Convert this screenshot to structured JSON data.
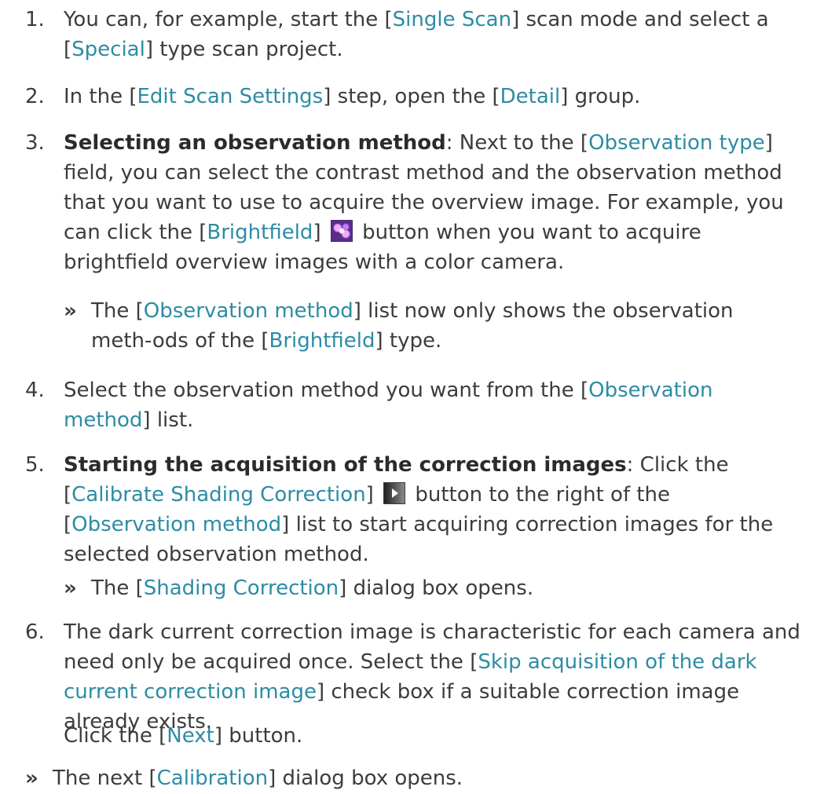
{
  "steps": [
    {
      "number": "1.",
      "parts": [
        {
          "t": "You can, for example, start the ["
        },
        {
          "t": "Single Scan",
          "link": true
        },
        {
          "t": "] scan mode and select a ["
        },
        {
          "t": "Special",
          "link": true
        },
        {
          "t": "] type scan project."
        }
      ]
    },
    {
      "number": "2.",
      "parts": [
        {
          "t": "In the ["
        },
        {
          "t": "Edit Scan Settings",
          "link": true
        },
        {
          "t": "] step, open the ["
        },
        {
          "t": "Detail",
          "link": true
        },
        {
          "t": "] group."
        }
      ]
    },
    {
      "number": "3.",
      "parts": [
        {
          "t": "Selecting an observation method",
          "bold": true
        },
        {
          "t": ": Next to the ["
        },
        {
          "t": "Observation type",
          "link": true
        },
        {
          "t": "] field, you can select the contrast method and the observation method that you want to use to acquire the overview image. For example, you can click the ["
        },
        {
          "t": "Brightfield",
          "link": true
        },
        {
          "t": "] "
        },
        {
          "icon": "brightfield-icon"
        },
        {
          "t": " button when you want to acquire brightfield overview images with a color camera."
        }
      ]
    },
    {
      "number": "4.",
      "parts": [
        {
          "t": "Select the observation method you want from the ["
        },
        {
          "t": "Observation method",
          "link": true
        },
        {
          "t": "] list."
        }
      ]
    },
    {
      "number": "5.",
      "parts": [
        {
          "t": "Starting the acquisition of the correction images",
          "bold": true
        },
        {
          "t": ": Click the ["
        },
        {
          "t": "Calibrate Shading Correction",
          "link": true
        },
        {
          "t": "] "
        },
        {
          "icon": "shading-correction-icon"
        },
        {
          "t": " button to the right of the ["
        },
        {
          "t": "Observation method",
          "link": true
        },
        {
          "t": "] list to start acquiring correction images for the selected observation method."
        }
      ]
    },
    {
      "number": "6.",
      "parts": [
        {
          "t": "The dark current correction image is characteristic for each camera and need only be acquired once. Select the ["
        },
        {
          "t": "Skip acquisition of the dark current correction image",
          "link": true
        },
        {
          "t": "] check box if a suitable correction image already exists."
        }
      ]
    }
  ],
  "results": [
    {
      "marker": "»",
      "parts": [
        {
          "t": "The ["
        },
        {
          "t": "Observation method",
          "link": true
        },
        {
          "t": "] list now only shows the observation meth-ods of the ["
        },
        {
          "t": "Brightfield",
          "link": true
        },
        {
          "t": "] type."
        }
      ]
    },
    {
      "marker": "»",
      "parts": [
        {
          "t": "The ["
        },
        {
          "t": "Shading Correction",
          "link": true
        },
        {
          "t": "] dialog box opens."
        }
      ]
    }
  ],
  "step6_extra": {
    "parts": [
      {
        "t": "Click the ["
      },
      {
        "t": "Next",
        "link": true
      },
      {
        "t": "] button."
      }
    ]
  },
  "final": {
    "marker": "»",
    "parts": [
      {
        "t": "The next ["
      },
      {
        "t": "Calibration",
        "link": true
      },
      {
        "t": "] dialog box opens."
      }
    ]
  },
  "colors": {
    "text": "#3c3c3c",
    "link": "#2d8ca4"
  }
}
